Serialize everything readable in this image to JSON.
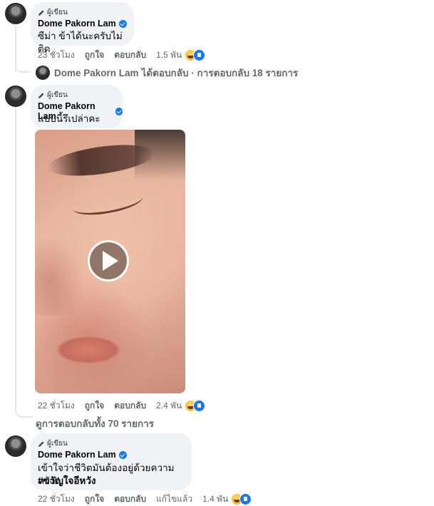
{
  "comments": [
    {
      "badge": "ผู้เขียน",
      "author": "Dome Pakorn Lam",
      "text": "ซีม่า ข้าได้นะครับไม่ติด",
      "time": "23 ชั่วโมง",
      "like": "ถูกใจ",
      "reply": "ตอบกลับ",
      "reactions": "1.5 พัน"
    },
    {
      "badge": "ผู้เขียน",
      "author": "Dome Pakorn Lam",
      "text": "แบบนี้รึเปล่าคะ",
      "time": "22 ชั่วโมง",
      "like": "ถูกใจ",
      "reply": "ตอบกลับ",
      "reactions": "2.4 พัน"
    },
    {
      "badge": "ผู้เขียน",
      "author": "Dome Pakorn Lam",
      "text_line1": "เข้าใจว่าชีวิตมันต้องอยู่ด้วยความหวัง!!",
      "text_line2": "#ขวัญใจอีหวัง",
      "time": "22 ชั่วโมง",
      "like": "ถูกใจ",
      "reply": "ตอบกลับ",
      "edited": "แก้ไขแล้ว",
      "reactions": "1.4 พัน"
    }
  ],
  "replies_summary": {
    "name": "Dome Pakorn Lam",
    "text": "ได้ตอบกลับ · การตอบกลับ 18 รายการ"
  },
  "view_all_replies": "ดูการตอบกลับทั้ง 70 รายการ",
  "colors": {
    "bubble": "#f0f2f5",
    "meta": "#65676b",
    "verified": "#1877f2"
  },
  "icons": [
    "pencil-icon",
    "verified-icon",
    "haha-reaction-icon",
    "like-reaction-icon",
    "play-icon"
  ]
}
